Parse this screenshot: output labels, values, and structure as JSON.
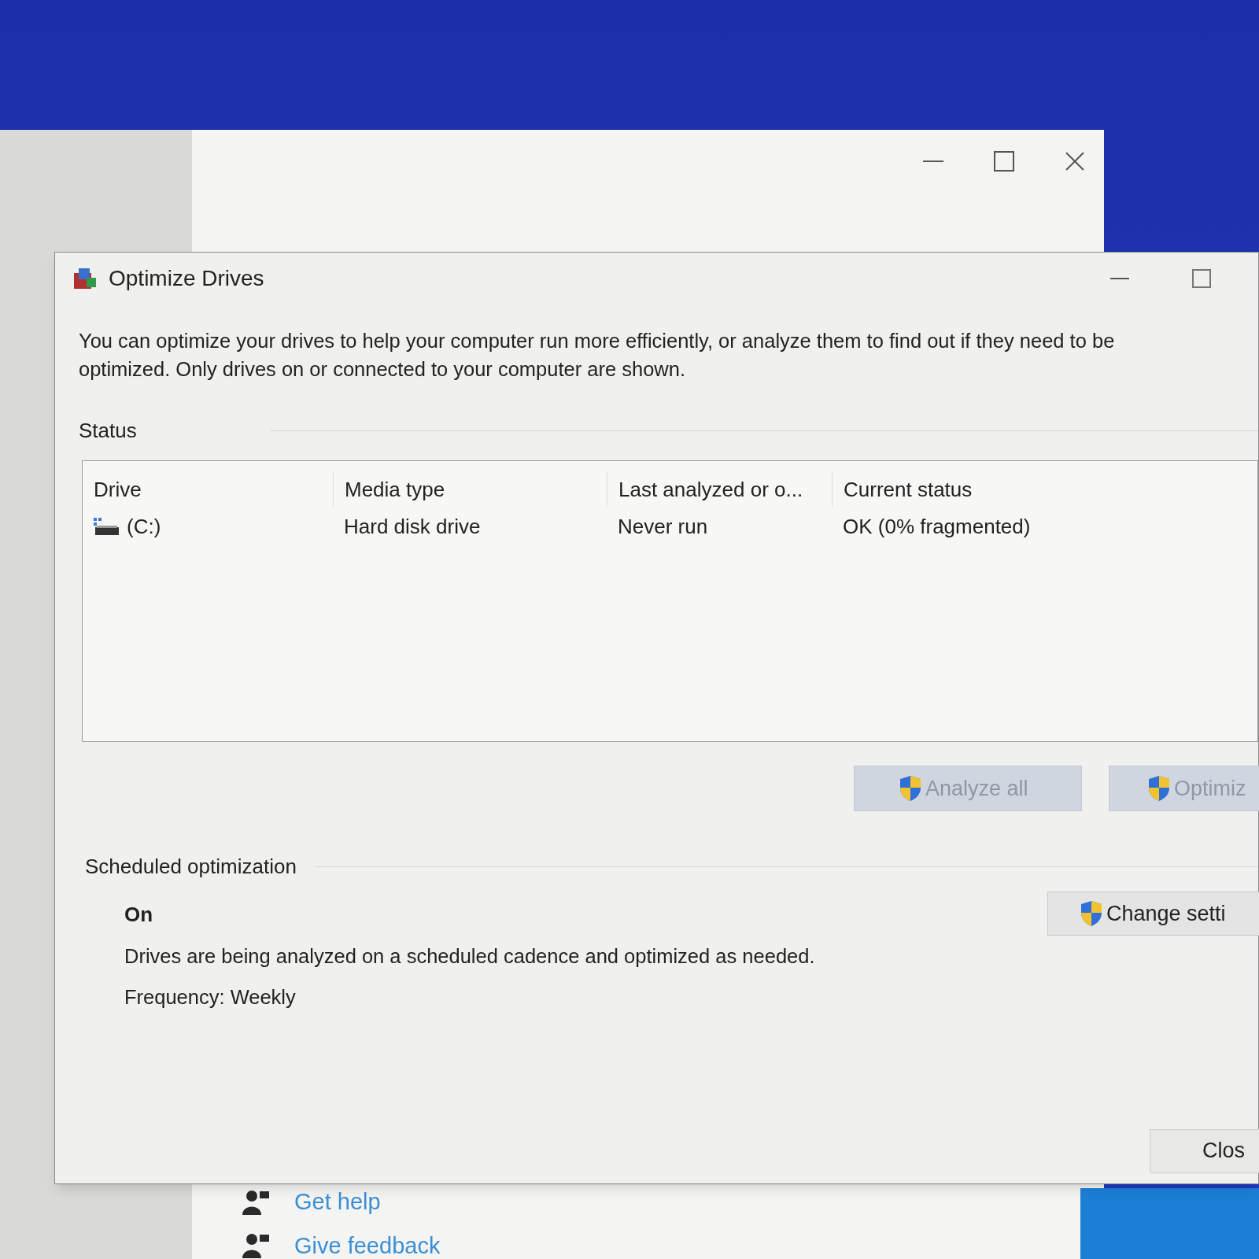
{
  "background_window": {
    "links": [
      {
        "label": "Get help"
      },
      {
        "label": "Give feedback"
      }
    ]
  },
  "dialog": {
    "title": "Optimize Drives",
    "description_lines": [
      "You can optimize your drives to help your computer run more efficiently, or analyze them to find out if they need to be",
      "optimized. Only drives on or connected to your computer are shown."
    ],
    "status_label": "Status",
    "columns": [
      "Drive",
      "Media type",
      "Last analyzed or o...",
      "Current status"
    ],
    "rows": [
      {
        "cells": [
          "(C:)",
          "Hard disk drive",
          "Never run",
          "OK (0% fragmented)"
        ]
      }
    ],
    "buttons": [
      {
        "label": "Analyze all",
        "disabled": true
      },
      {
        "label": "Optimiz",
        "disabled": true
      }
    ],
    "schedule": {
      "heading": "Scheduled optimization",
      "state": "On",
      "description": "Drives are being analyzed on a scheduled cadence and optimized as needed.",
      "frequency": "Frequency: Weekly",
      "button": "Change setti"
    },
    "close_button": "Clos"
  }
}
